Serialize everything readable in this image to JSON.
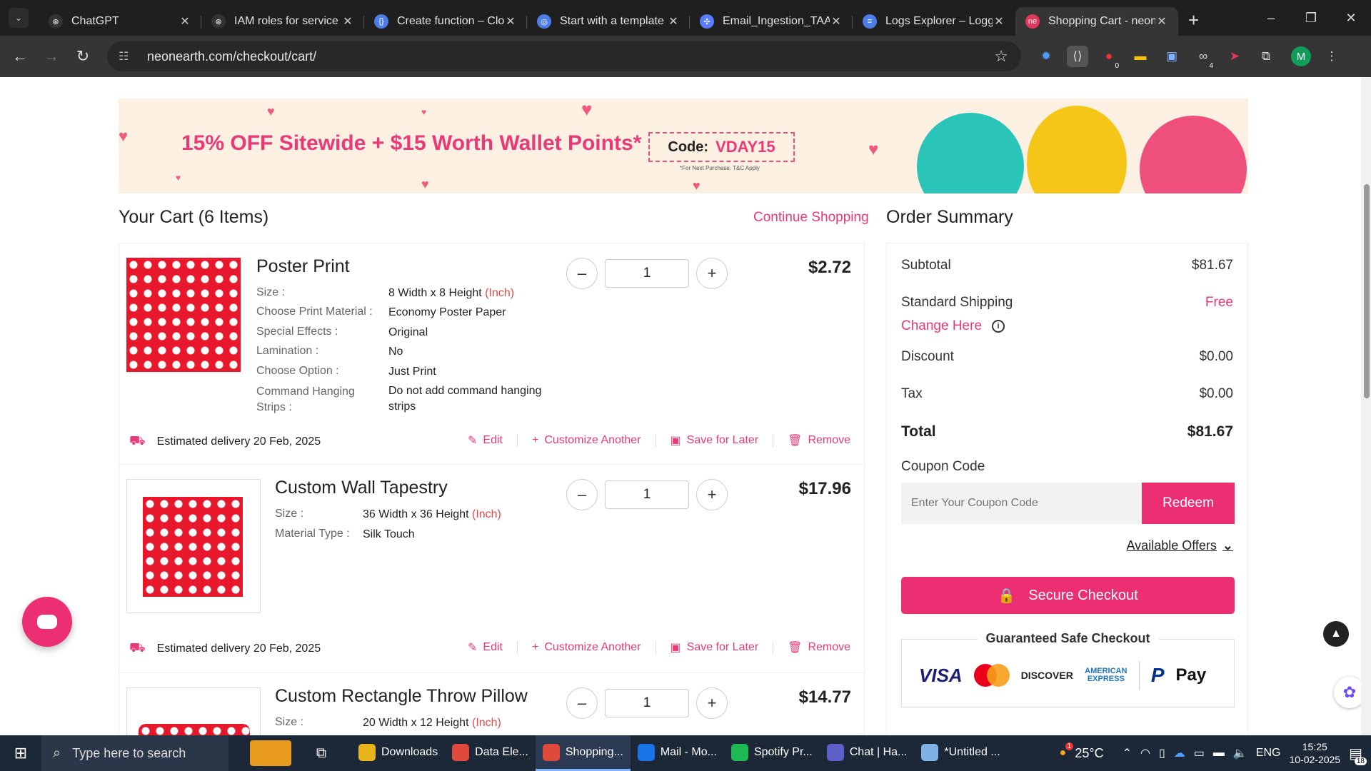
{
  "browser": {
    "tabs": [
      {
        "label": "ChatGPT",
        "color": "#333333",
        "glyph": "⊛"
      },
      {
        "label": "IAM roles for service",
        "color": "#333333",
        "glyph": "⊛"
      },
      {
        "label": "Create function – Clo",
        "color": "#4f7de8",
        "glyph": "{}"
      },
      {
        "label": "Start with a template",
        "color": "#4f7de8",
        "glyph": "◎"
      },
      {
        "label": "Email_Ingestion_TAA",
        "color": "#5b7cff",
        "glyph": "✣"
      },
      {
        "label": "Logs Explorer – Logg",
        "color": "#4f7de8",
        "glyph": "≡"
      },
      {
        "label": "Shopping Cart - neon",
        "color": "#e2365b",
        "glyph": "ne"
      }
    ],
    "url": "neonearth.com/checkout/cart/",
    "ext_badge_1": "0",
    "ext_badge_2": "4",
    "profile_initial": "M"
  },
  "banner": {
    "headline": "15% OFF Sitewide + $15 Worth Wallet Points*",
    "code_label": "Code:",
    "code": "VDAY15",
    "terms": "*For Next Purchase. T&C Apply"
  },
  "cart": {
    "title": "Your Cart (6 Items)",
    "continue_label": "Continue Shopping",
    "items": [
      {
        "name": "Poster Print",
        "price": "$2.72",
        "qty": "1",
        "specs": [
          {
            "label": "Size :",
            "value": "8 Width x 8 Height",
            "unit": "(Inch)"
          },
          {
            "label": "Choose Print Material :",
            "value": "Economy Poster Paper",
            "unit": ""
          },
          {
            "label": "Special Effects :",
            "value": "Original",
            "unit": ""
          },
          {
            "label": "Lamination :",
            "value": "No",
            "unit": ""
          },
          {
            "label": "Choose Option :",
            "value": "Just Print",
            "unit": ""
          },
          {
            "label": "Command Hanging Strips :",
            "value": "Do not add command hanging strips",
            "unit": ""
          }
        ],
        "delivery": "Estimated delivery 20 Feb, 2025"
      },
      {
        "name": "Custom Wall Tapestry",
        "price": "$17.96",
        "qty": "1",
        "specs": [
          {
            "label": "Size :",
            "value": "36 Width x 36 Height",
            "unit": "(Inch)"
          },
          {
            "label": "Material Type :",
            "value": "Silk Touch",
            "unit": ""
          }
        ],
        "delivery": "Estimated delivery 20 Feb, 2025"
      },
      {
        "name": "Custom Rectangle Throw Pillow",
        "price": "$14.77",
        "qty": "1",
        "specs": [
          {
            "label": "Size :",
            "value": "20 Width x 12 Height",
            "unit": "(Inch)"
          }
        ]
      }
    ],
    "actions": {
      "edit": "Edit",
      "customize": "Customize Another",
      "save": "Save for Later",
      "remove": "Remove"
    }
  },
  "summary": {
    "title": "Order Summary",
    "subtotal_label": "Subtotal",
    "subtotal": "$81.67",
    "shipping_label": "Standard Shipping",
    "shipping": "Free",
    "change_label": "Change Here",
    "discount_label": "Discount",
    "discount": "$0.00",
    "tax_label": "Tax",
    "tax": "$0.00",
    "total_label": "Total",
    "total": "$81.67",
    "coupon_label": "Coupon Code",
    "coupon_placeholder": "Enter Your Coupon Code",
    "redeem_label": "Redeem",
    "offers_label": "Available Offers",
    "checkout_label": "Secure Checkout",
    "safe_title": "Guaranteed Safe Checkout",
    "payments": {
      "visa": "VISA",
      "discover": "DISCOVER",
      "amex": "AMERICAN EXPRESS",
      "applepay": "Pay"
    }
  },
  "taskbar": {
    "search_placeholder": "Type here to search",
    "apps": [
      {
        "label": "Downloads",
        "color": "#e8b41c",
        "active": false
      },
      {
        "label": "Data Ele...",
        "color": "#e04a3a",
        "active": false
      },
      {
        "label": "Shopping...",
        "color": "#e04a3a",
        "active": true
      },
      {
        "label": "Mail - Mo...",
        "color": "#1a73e8",
        "active": false
      },
      {
        "label": "Spotify Pr...",
        "color": "#1db954",
        "active": false
      },
      {
        "label": "Chat | Ha...",
        "color": "#5b5fc7",
        "active": false
      },
      {
        "label": "*Untitled ...",
        "color": "#7fb2e5",
        "active": false
      }
    ],
    "weather": "25°C",
    "weather_badge": "1",
    "lang": "ENG",
    "time": "15:25",
    "date": "10-02-2025",
    "notif_count": "18"
  }
}
